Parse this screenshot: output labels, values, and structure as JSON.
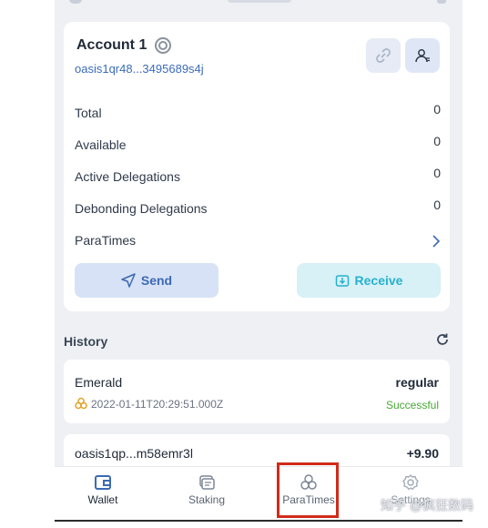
{
  "account": {
    "name": "Account 1",
    "address": "oasis1qr48...3495689s4j"
  },
  "balances": [
    {
      "label": "Total",
      "value": "0"
    },
    {
      "label": "Available",
      "value": "0"
    },
    {
      "label": "Active Delegations",
      "value": "0"
    },
    {
      "label": "Debonding Delegations",
      "value": "0"
    }
  ],
  "paratimes_row": {
    "label": "ParaTimes"
  },
  "actions": {
    "send": "Send",
    "receive": "Receive"
  },
  "history": {
    "title": "History",
    "items": [
      {
        "name": "Emerald",
        "type": "regular",
        "timestamp": "2022-01-11T20:29:51.000Z",
        "status": "Successful"
      },
      {
        "name": "oasis1qp...m58emr3l",
        "amount": "+9.90"
      }
    ]
  },
  "tabs": {
    "wallet": "Wallet",
    "staking": "Staking",
    "paratimes": "ParaTimes",
    "settings": "Settings"
  },
  "watermark": "知乎 @疯狂数码",
  "colors": {
    "address_blue": "#3b6cb8",
    "send_bg": "#d7e2f6",
    "receive_bg": "#d7f1f6",
    "success_green": "#47a834",
    "highlight_red": "#d12a1a"
  }
}
